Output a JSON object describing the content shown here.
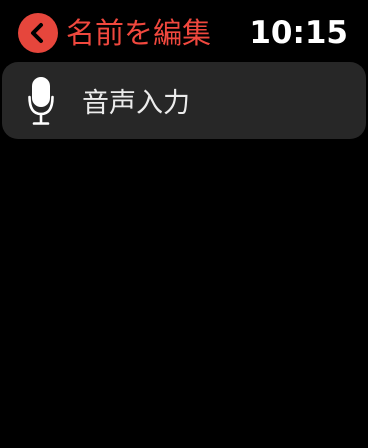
{
  "header": {
    "back_label": "名前を編集",
    "time": "10:15",
    "back_icon": "chevron-left-icon"
  },
  "menu": {
    "items": [
      {
        "label": "音声入力",
        "icon": "microphone-icon"
      }
    ]
  },
  "colors": {
    "accent": "#e6463c",
    "background": "#000000",
    "cell_background": "#272727",
    "text": "#ececec"
  }
}
